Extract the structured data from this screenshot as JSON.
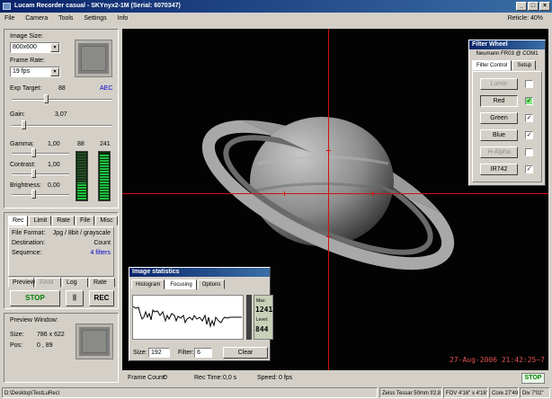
{
  "window": {
    "title": "Lucam Recorder casual - SKYnyx2-1M (Serial: 6070347)",
    "buttons": [
      "_",
      "□",
      "×"
    ]
  },
  "menu": {
    "items": [
      "File",
      "Camera",
      "Tools",
      "Settings",
      "Info"
    ],
    "reticle": "Reticle: 40%"
  },
  "camera": {
    "image_size_label": "Image Size:",
    "image_size_value": "800x600",
    "frame_rate_label": "Frame Rate:",
    "frame_rate_value": "19 fps",
    "exp_target_label": "Exp Target:",
    "exp_target_value": "88",
    "aec_label": "AEC",
    "gain_label": "Gain:",
    "gain_value": "3,07",
    "gamma_label": "Gamma:",
    "gamma_value": "1,00",
    "contrast_label": "Contrast:",
    "contrast_value": "1,00",
    "brightness_label": "Brightness:",
    "brightness_value": "0,00",
    "meter_left_value": "88",
    "meter_right_value": "241",
    "meter_left_fraction": 0.35,
    "meter_right_fraction": 0.95
  },
  "record": {
    "tabs": [
      "Rec",
      "Limit",
      "Rate",
      "File",
      "Misc"
    ],
    "file_format_label": "File Format:",
    "file_format_value": "Jpg / 8bit / grayscale",
    "destination_label": "Destination:",
    "destination_value": "Count",
    "sequence_label": "Sequence:",
    "sequence_value": "4 filters",
    "mode_tabs": [
      "Preview",
      "RAM",
      "Log",
      "Rate"
    ],
    "stop_label": "STOP",
    "pause_label": "||",
    "rec_label": "REC"
  },
  "preview": {
    "title": "Preview Window:",
    "size_label": "Size:",
    "size_value": "786 x 622",
    "pos_label": "Pos:",
    "pos_value": "0 , 89"
  },
  "overlay": {
    "timestamp": "27-Aug-2006 21:42:25~7"
  },
  "filter_wheel": {
    "title": "Filter Wheel",
    "device": "Neumann FR03 @ COM1",
    "tabs": [
      "Filter Control",
      "Setup"
    ],
    "filters": [
      {
        "name": "Lumin",
        "enabled": false,
        "checked": false,
        "selected": false
      },
      {
        "name": "Red",
        "enabled": true,
        "checked": true,
        "selected": true
      },
      {
        "name": "Green",
        "enabled": true,
        "checked": true,
        "selected": false
      },
      {
        "name": "Blue",
        "enabled": true,
        "checked": true,
        "selected": false
      },
      {
        "name": "H-Alpha",
        "enabled": false,
        "checked": false,
        "selected": false
      },
      {
        "name": "IR742",
        "enabled": true,
        "checked": true,
        "selected": false
      }
    ],
    "check_mark": "✓"
  },
  "image_stats": {
    "title": "Image statistics",
    "tabs": [
      "Histogram",
      "Focusing",
      "Options"
    ],
    "max_label": "Max:",
    "max_value": "1241",
    "level_label": "Level:",
    "level_value": "844",
    "size_label": "Size:",
    "size_value": "192",
    "filter_label": "Filter:",
    "filter_value": "6",
    "clear_label": "Clear"
  },
  "status": {
    "frame_count_label": "Frame Count:",
    "frame_count_value": "0",
    "rec_time_label": "Rec Time:",
    "rec_time_value": "0,0 s",
    "speed_label": "Speed:",
    "speed_value": "0 fps",
    "state": "STOP"
  },
  "bottom": {
    "path": "D:\\Desktop\\TestLuRec\\",
    "lens": "Zeiss Tessar 50mm f/2,8",
    "fov": "FOV 4'16\" x 4'16\"",
    "core": "Core 27'49\"",
    "div": "Div 7'02\""
  }
}
